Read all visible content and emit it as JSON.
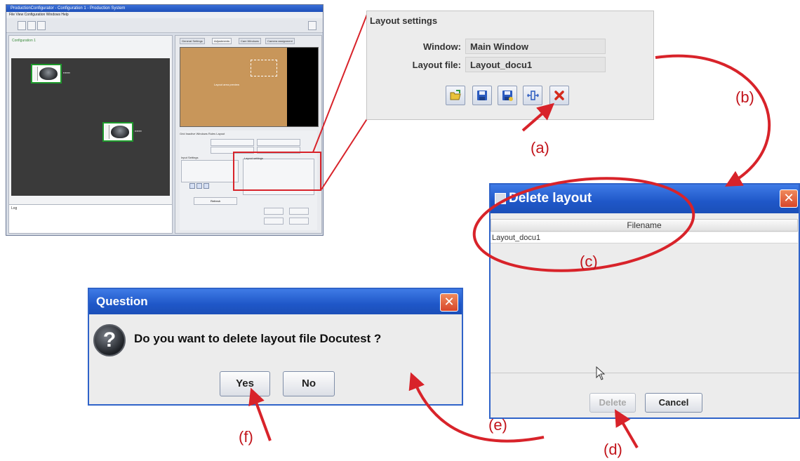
{
  "overview": {
    "title": "ProductionConfigurator - Configuration 1 - Production System",
    "menu": "File  View  Configuration  Windows  Help",
    "left_label": "Configuration 1",
    "log_label": "Log",
    "tabs": [
      "General Settings",
      "Adjustments",
      "Cam Windows",
      "Camera assignment"
    ],
    "preview_text": "Layout area preview",
    "lower_tabs": "Grid Inactive  Windows  Rules  Layout",
    "layout_settings_mini": "Layout settings",
    "input_settings_mini": "Input Settings",
    "refresh_mini": "Refresh"
  },
  "layout_settings": {
    "title": "Layout settings",
    "window_label": "Window:",
    "window_value": "Main Window",
    "layout_file_label": "Layout file:",
    "layout_file_value": "Layout_docu1",
    "buttons": [
      {
        "name": "open-folder-icon",
        "color": "#e8c23a"
      },
      {
        "name": "save-icon",
        "color": "#2b5bbf"
      },
      {
        "name": "save-as-icon",
        "color": "#2b5bbf"
      },
      {
        "name": "arrange-icon",
        "color": "#2b5bbf"
      },
      {
        "name": "delete-icon",
        "color": "#d42a1c"
      }
    ]
  },
  "steps": {
    "a": "(a)",
    "b": "(b)",
    "c": "(c)",
    "d": "(d)",
    "e": "(e)",
    "f": "(f)"
  },
  "delete_dialog": {
    "title": "Delete layout",
    "column_header": "Filename",
    "rows": [
      "Layout_docu1"
    ],
    "delete_label": "Delete",
    "cancel_label": "Cancel",
    "close_label": "✕"
  },
  "question_dialog": {
    "title": "Question",
    "icon_glyph": "?",
    "message": "Do you want to delete layout file Docutest ?",
    "yes_label": "Yes",
    "no_label": "No",
    "close_label": "✕"
  },
  "colors": {
    "annotation_red": "#d8232a",
    "title_blue": "#1f57c8"
  }
}
